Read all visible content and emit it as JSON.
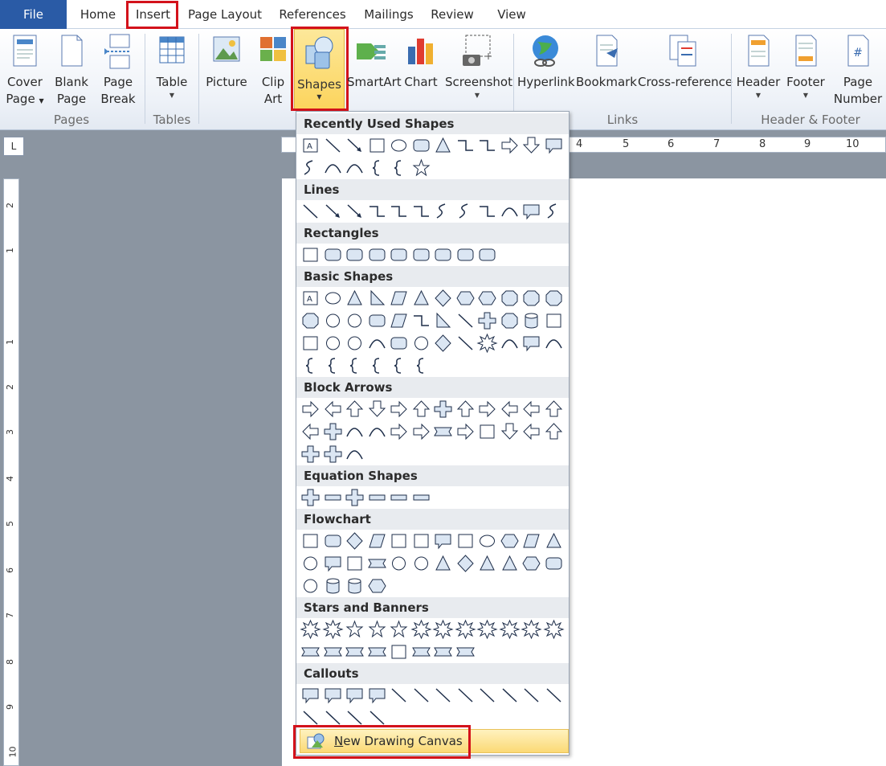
{
  "tabs": [
    {
      "label": "File"
    },
    {
      "label": "Home"
    },
    {
      "label": "Insert"
    },
    {
      "label": "Page Layout"
    },
    {
      "label": "References"
    },
    {
      "label": "Mailings"
    },
    {
      "label": "Review"
    },
    {
      "label": "View"
    }
  ],
  "ribbon": {
    "pages": {
      "cover_1": "Cover",
      "cover_2": "Page",
      "blank_1": "Blank",
      "blank_2": "Page",
      "break_1": "Page",
      "break_2": "Break",
      "group": "Pages"
    },
    "tables": {
      "table": "Table",
      "group": "Tables"
    },
    "illus": {
      "picture": "Picture",
      "clip_1": "Clip",
      "clip_2": "Art",
      "shapes": "Shapes",
      "smartart": "SmartArt",
      "chart": "Chart",
      "screenshot": "Screenshot"
    },
    "links": {
      "hyperlink": "Hyperlink",
      "bookmark": "Bookmark",
      "crossref": "Cross-reference",
      "group": "Links"
    },
    "hf": {
      "header": "Header",
      "footer": "Footer",
      "pagenum_1": "Page",
      "pagenum_2": "Number",
      "group": "Header & Footer"
    }
  },
  "ruler": {
    "h": [
      "4",
      "5",
      "6",
      "7",
      "8",
      "9",
      "10"
    ],
    "v": [
      "2",
      "1",
      "1",
      "2",
      "3",
      "4",
      "5",
      "6",
      "7",
      "8",
      "9",
      "10"
    ],
    "corner": "L"
  },
  "dropdown": {
    "sections": [
      {
        "title": "Recently Used Shapes"
      },
      {
        "title": "Lines"
      },
      {
        "title": "Rectangles"
      },
      {
        "title": "Basic Shapes"
      },
      {
        "title": "Block Arrows"
      },
      {
        "title": "Equation Shapes"
      },
      {
        "title": "Flowchart"
      },
      {
        "title": "Stars and Banners"
      },
      {
        "title": "Callouts"
      }
    ],
    "new_canvas_prefix": "N",
    "new_canvas_rest": "ew Drawing Canvas"
  },
  "colors": {
    "accent": "#2a5ba6",
    "highlight": "#fcd45d",
    "redbox": "#d3121b"
  }
}
